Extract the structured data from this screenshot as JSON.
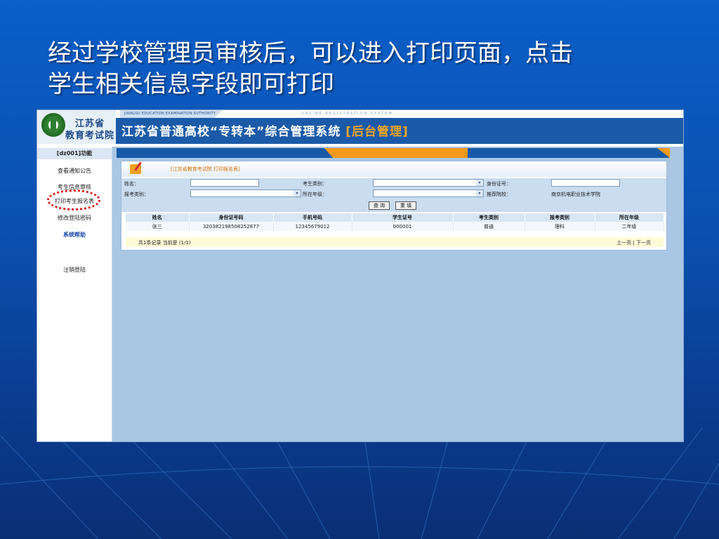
{
  "slide": {
    "title_line1": "经过学校管理员审核后，可以进入打印页面，点击",
    "title_line2": "学生相关信息字段即可打印"
  },
  "header": {
    "logo_line1": "江苏省",
    "logo_line2": "教育考试院",
    "authority_tag": "JIANGSU EDUCATION EXAMINATION AUTHORITY",
    "online_tag": "ONLINE REGISTRATION SYSTEM",
    "system_title": "江苏省普通高校“专转本”综合管理系统",
    "system_title_tag": "[后台管理]"
  },
  "sidebar": {
    "header": "[dz001]功能",
    "items": [
      {
        "label": "查看通知公告"
      },
      {
        "label": "考生信息审核"
      },
      {
        "label": "打印考生报名表"
      },
      {
        "label": "修改登陆密码"
      },
      {
        "label": "系统帮助"
      },
      {
        "label": "注销登陆"
      }
    ]
  },
  "panel": {
    "title": "[江苏省教育考试院 打印报名表]",
    "form": {
      "name_label": "姓名：",
      "category_label": "考生类别：",
      "id_label": "身份证号：",
      "exam_type_label": "报考类别：",
      "grade_label": "所在年级：",
      "school_label": "推荐院校：",
      "school_value": "南京机电职业技术学院",
      "query_button": "查 询",
      "reset_button": "重 填"
    },
    "table": {
      "headers": [
        "姓名",
        "身份证号码",
        "手机号码",
        "学生证号",
        "考生类别",
        "报考类别",
        "所在年级"
      ],
      "rows": [
        [
          "张三",
          "320382198508252877",
          "12345679012",
          "000001",
          "普通",
          "理科",
          "二年级"
        ]
      ]
    },
    "pager": {
      "summary": "共1条记录 当前是 (1/1)",
      "nav": "上一页 | 下一页"
    }
  },
  "colors": {
    "slide_bg": "#0a5fc8",
    "header_bg": "#1a5aa8",
    "accent_orange": "#f59a1a",
    "highlight_circle": "#d81c1c"
  }
}
